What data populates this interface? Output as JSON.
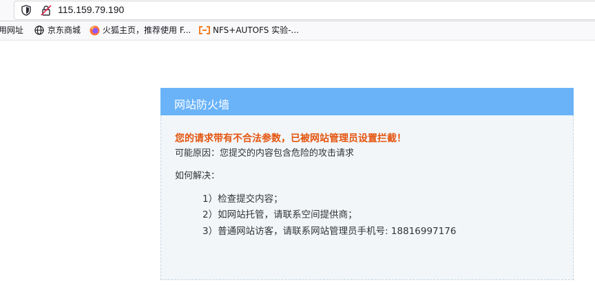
{
  "browser": {
    "url": "115.159.79.190",
    "bookmarks": [
      {
        "label": "用网址",
        "icon": "bookmark-icon"
      },
      {
        "label": "京东商城",
        "icon": "globe-icon"
      },
      {
        "label": "火狐主页，推荐使用 F...",
        "icon": "firefox-icon"
      },
      {
        "label": "NFS+AUTOFS 实验-...",
        "icon": "brackets-icon"
      }
    ]
  },
  "firewall": {
    "title": "网站防火墙",
    "warning": "您的请求带有不合法参数，已被网站管理员设置拦截！",
    "reason": "可能原因：您提交的内容包含危险的攻击请求",
    "how_label": "如何解决：",
    "steps": [
      "1）检查提交内容；",
      "2）如网站托管，请联系空间提供商；",
      "3）普通网站访客，请联系网站管理员手机号: 18816997176"
    ]
  },
  "colors": {
    "header_bg": "#6ab3f8",
    "warning_text": "#e4540d",
    "card_bg": "#f2f6f9"
  }
}
